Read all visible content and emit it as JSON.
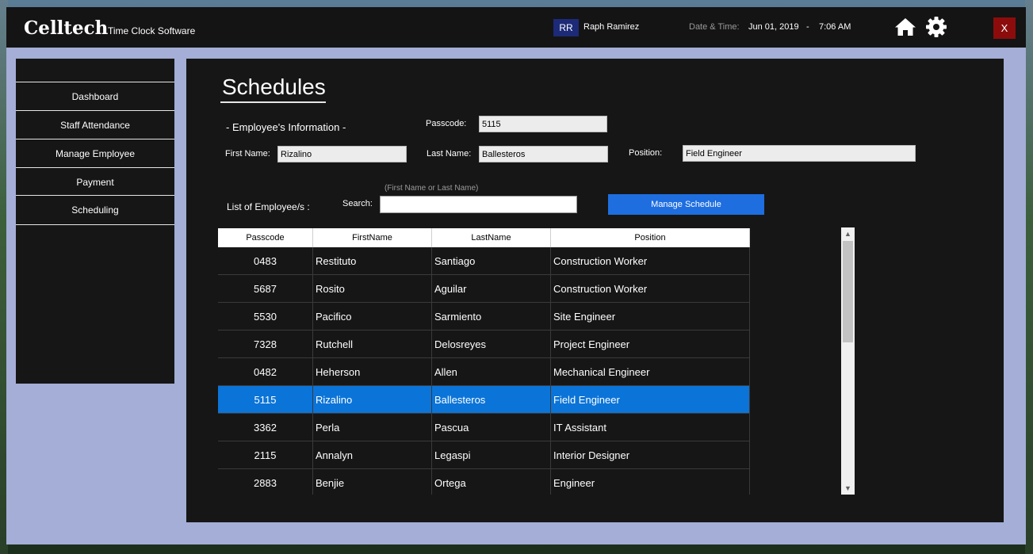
{
  "app": {
    "brand": "Celltech",
    "brand_sub": "Time Clock Software",
    "user_initials": "RR",
    "user_name": "Raph Ramirez",
    "datetime_label": "Date & Time:",
    "date": "Jun 01, 2019",
    "separator": "-",
    "time": "7:06 AM",
    "close_label": "X",
    "icons": [
      "home-icon",
      "gear-icon"
    ]
  },
  "sidebar": {
    "items": [
      {
        "label": "Dashboard"
      },
      {
        "label": "Staff Attendance"
      },
      {
        "label": "Manage Employee"
      },
      {
        "label": "Payment"
      },
      {
        "label": "Scheduling"
      }
    ]
  },
  "main": {
    "title": "Schedules",
    "section_info": "- Employee's Information -",
    "passcode_label": "Passcode:",
    "passcode_value": "5115",
    "first_name_label": "First Name:",
    "first_name_value": "Rizalino",
    "last_name_label": "Last Name:",
    "last_name_value": "Ballesteros",
    "position_label": "Position:",
    "position_value": "Field Engineer",
    "list_label": "List of Employee/s :",
    "search_label": "Search:",
    "search_hint": "(First Name or Last Name)",
    "search_value": "",
    "manage_button": "Manage Schedule"
  },
  "grid": {
    "columns": [
      "Passcode",
      "FirstName",
      "LastName",
      "Position"
    ],
    "rows": [
      {
        "passcode": "0483",
        "first": "Restituto",
        "last": "Santiago",
        "position": "Construction Worker"
      },
      {
        "passcode": "5687",
        "first": "Rosito",
        "last": "Aguilar",
        "position": "Construction Worker"
      },
      {
        "passcode": "5530",
        "first": "Pacifico",
        "last": "Sarmiento",
        "position": "Site Engineer"
      },
      {
        "passcode": "7328",
        "first": "Rutchell",
        "last": "Delosreyes",
        "position": "Project Engineer"
      },
      {
        "passcode": "0482",
        "first": "Heherson",
        "last": "Allen",
        "position": "Mechanical Engineer"
      },
      {
        "passcode": "5115",
        "first": "Rizalino",
        "last": "Ballesteros",
        "position": "Field Engineer"
      },
      {
        "passcode": "3362",
        "first": "Perla",
        "last": "Pascua",
        "position": "IT Assistant"
      },
      {
        "passcode": "2115",
        "first": "Annalyn",
        "last": "Legaspi",
        "position": "Interior Designer"
      },
      {
        "passcode": "2883",
        "first": "Benjie",
        "last": "Ortega",
        "position": "Engineer"
      }
    ],
    "selected_index": 5
  },
  "colors": {
    "accent": "#1e6ee0",
    "selection": "#0b74d8",
    "close": "#8c0c0c",
    "frame": "#a4aed6"
  }
}
